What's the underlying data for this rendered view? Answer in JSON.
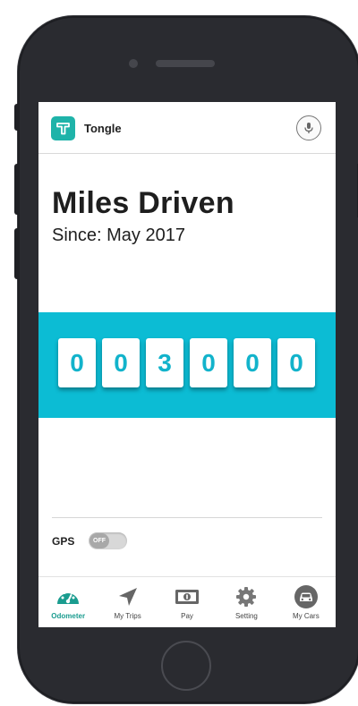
{
  "app": {
    "name": "Tongle"
  },
  "main": {
    "title": "Miles Driven",
    "since": "Since: May 2017",
    "odometer_digits": [
      "0",
      "0",
      "3",
      "0",
      "0",
      "0"
    ]
  },
  "gps": {
    "label": "GPS",
    "toggle_state": "OFF"
  },
  "nav": {
    "items": [
      {
        "label": "Odometer",
        "icon": "speedometer-icon",
        "active": true
      },
      {
        "label": "My Trips",
        "icon": "navigation-arrow-icon",
        "active": false
      },
      {
        "label": "Pay",
        "icon": "money-bill-icon",
        "active": false
      },
      {
        "label": "Setting",
        "icon": "gear-icon",
        "active": false
      },
      {
        "label": "My Cars",
        "icon": "car-icon",
        "active": false
      }
    ]
  },
  "colors": {
    "accent_teal": "#1fb3a9",
    "odometer_band": "#0cbcd4",
    "digit_text": "#12b3cb",
    "frame": "#2a2b30"
  }
}
